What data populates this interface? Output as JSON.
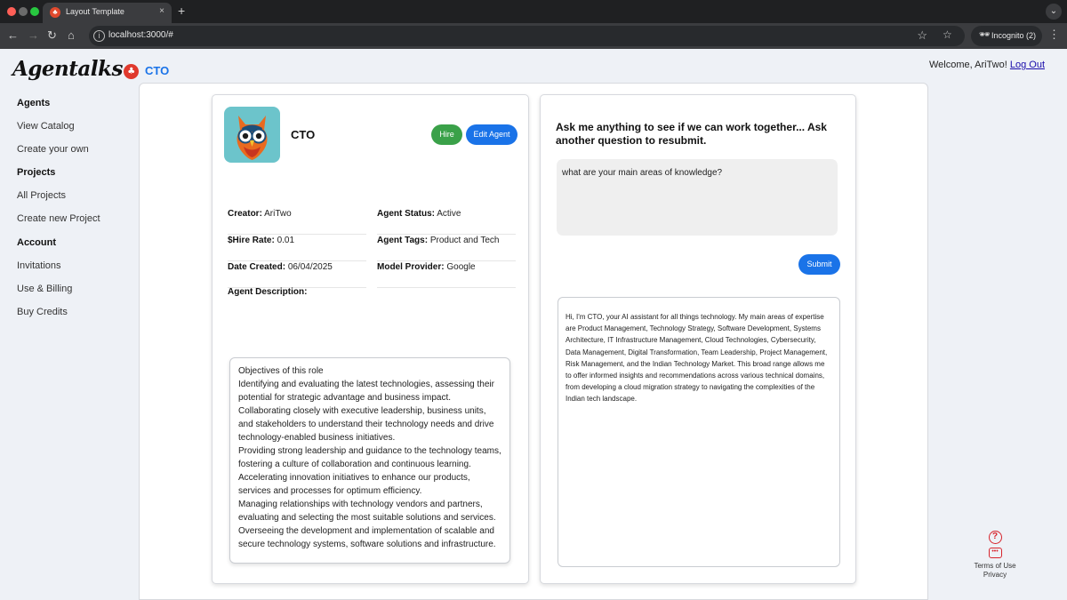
{
  "browser": {
    "tab_title": "Layout Template",
    "tab_close": "×",
    "new_tab": "+",
    "tab_menu": "⌄",
    "nav_back": "←",
    "nav_forward": "→",
    "nav_reload": "↻",
    "nav_home": "⌂",
    "url": "localhost:3000/#",
    "incognito_label": "Incognito (2)",
    "star": "☆",
    "kebab": "⋮"
  },
  "app": {
    "logo_text": "Agentalks",
    "page_title": "CTO",
    "welcome_text": "Welcome, AriTwo!",
    "logout_label": "Log Out"
  },
  "sidebar": {
    "items": [
      {
        "label": "Agents",
        "heading": true
      },
      {
        "label": "View Catalog",
        "heading": false
      },
      {
        "label": "Create your own",
        "heading": false
      },
      {
        "label": "Projects",
        "heading": true
      },
      {
        "label": "All Projects",
        "heading": false
      },
      {
        "label": "Create new Project",
        "heading": false
      },
      {
        "label": "Account",
        "heading": true
      },
      {
        "label": "Invitations",
        "heading": false
      },
      {
        "label": "Use & Billing",
        "heading": false
      },
      {
        "label": "Buy Credits",
        "heading": false
      }
    ]
  },
  "agent": {
    "name": "CTO",
    "hire_label": "Hire",
    "edit_label": "Edit Agent",
    "fields": {
      "creator_label": "Creator:",
      "creator_value": "AriTwo",
      "status_label": "Agent Status:",
      "status_value": "Active",
      "rate_label": "$Hire Rate:",
      "rate_value": "0.01",
      "tags_label": "Agent Tags:",
      "tags_value": "Product and Tech",
      "created_label": "Date Created:",
      "created_value": "06/04/2025",
      "model_label": "Model Provider:",
      "model_value": "Google"
    },
    "description_label": "Agent Description:",
    "description": "Objectives of this role\nIdentifying and evaluating the latest technologies, assessing their potential for strategic advantage and business impact.\nCollaborating closely with executive leadership, business units, and stakeholders to understand their technology needs and drive technology-enabled business initiatives.\nProviding strong leadership and guidance to the technology teams, fostering a culture of collaboration and continuous learning.\nAccelerating innovation initiatives to enhance our products, services and processes for optimum efficiency.\nManaging relationships with technology vendors and partners, evaluating and selecting the most suitable solutions and services.\nOverseeing the development and implementation of scalable and secure technology systems, software solutions and infrastructure."
  },
  "chat": {
    "title": "Ask me anything to see if we can work together... Ask another question to resubmit.",
    "question": "what are your main areas of knowledge?",
    "submit_label": "Submit",
    "answer": "Hi, I'm CTO, your AI assistant for all things technology.  My main areas of expertise are Product Management, Technology Strategy, Software Development, Systems Architecture, IT Infrastructure Management, Cloud Technologies, Cybersecurity, Data Management, Digital Transformation, Team Leadership, Project Management, Risk Management, and the Indian Technology Market. This broad range allows me to offer informed insights and recommendations across various technical domains, from developing a cloud migration strategy to navigating the complexities of the Indian tech landscape."
  },
  "footer": {
    "terms_label": "Terms of Use",
    "privacy_label": "Privacy"
  },
  "icons": {
    "help": "help-circle-icon",
    "chat": "chat-bubble-icon",
    "brand_color": "#e0392d",
    "accent_color": "#1a73e8",
    "hire_color": "#3aa149"
  }
}
